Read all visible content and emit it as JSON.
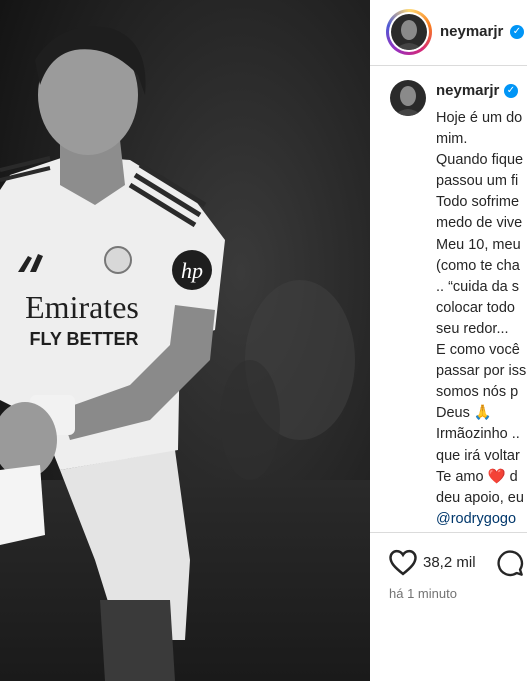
{
  "post": {
    "username": "neymarjr",
    "username_caption": "neymarjr",
    "verified_glyph": "✓",
    "caption_lines": [
      "Hoje é um do",
      "mim.",
      "Quando fique",
      "passou um fi",
      "Todo sofrime",
      "medo de vive",
      "Meu 10, meu",
      "(como te cha",
      ".. “cuida da s",
      "colocar todo",
      "seu redor...",
      "E como você",
      "passar por iss",
      "somos nós p",
      "Deus 🙏",
      "Irmãozinho ..",
      "que irá voltar",
      "Te amo ❤️ d",
      "deu apoio, eu"
    ],
    "mention": "@rodrygogo",
    "likes": "38,2 mil",
    "time": "há 1 minuto"
  },
  "photo": {
    "shirt_sponsor_line1": "Emirates",
    "shirt_sponsor_line2": "FLY BETTER",
    "sleeve_logo": "hp"
  },
  "icons": {
    "like": "heart-icon",
    "comment": "comment-icon",
    "verified": "verified-badge-icon"
  },
  "colors": {
    "verified": "#0095f6",
    "mention": "#00376b",
    "heart_emoji": "#e0245e"
  }
}
